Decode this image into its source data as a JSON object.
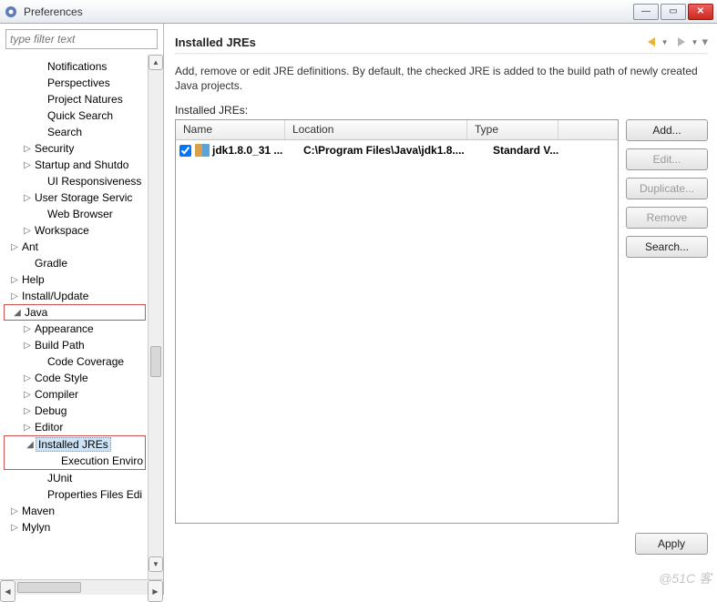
{
  "window": {
    "title": "Preferences"
  },
  "filter": {
    "placeholder": "type filter text"
  },
  "tree": {
    "items": [
      {
        "ind": 2,
        "tw": "",
        "lbl": "Notifications"
      },
      {
        "ind": 2,
        "tw": "",
        "lbl": "Perspectives"
      },
      {
        "ind": 2,
        "tw": "",
        "lbl": "Project Natures"
      },
      {
        "ind": 2,
        "tw": "",
        "lbl": "Quick Search"
      },
      {
        "ind": 2,
        "tw": "",
        "lbl": "Search"
      },
      {
        "ind": 1,
        "tw": "▷",
        "lbl": "Security"
      },
      {
        "ind": 1,
        "tw": "▷",
        "lbl": "Startup and Shutdo"
      },
      {
        "ind": 2,
        "tw": "",
        "lbl": "UI Responsiveness"
      },
      {
        "ind": 1,
        "tw": "▷",
        "lbl": "User Storage Servic"
      },
      {
        "ind": 2,
        "tw": "",
        "lbl": "Web Browser"
      },
      {
        "ind": 1,
        "tw": "▷",
        "lbl": "Workspace"
      },
      {
        "ind": 0,
        "tw": "▷",
        "lbl": "Ant"
      },
      {
        "ind": 1,
        "tw": "",
        "lbl": "Gradle"
      },
      {
        "ind": 0,
        "tw": "▷",
        "lbl": "Help"
      },
      {
        "ind": 0,
        "tw": "▷",
        "lbl": "Install/Update"
      },
      {
        "ind": 0,
        "tw": "◢",
        "lbl": "Java",
        "box": true
      },
      {
        "ind": 1,
        "tw": "▷",
        "lbl": "Appearance"
      },
      {
        "ind": 1,
        "tw": "▷",
        "lbl": "Build Path"
      },
      {
        "ind": 2,
        "tw": "",
        "lbl": "Code Coverage"
      },
      {
        "ind": 1,
        "tw": "▷",
        "lbl": "Code Style"
      },
      {
        "ind": 1,
        "tw": "▷",
        "lbl": "Compiler"
      },
      {
        "ind": 1,
        "tw": "▷",
        "lbl": "Debug"
      },
      {
        "ind": 1,
        "tw": "▷",
        "lbl": "Editor"
      },
      {
        "ind": 1,
        "tw": "◢",
        "lbl": "Installed JREs",
        "sel": true,
        "box2": true
      },
      {
        "ind": 3,
        "tw": "",
        "lbl": "Execution Enviro",
        "box2": true
      },
      {
        "ind": 2,
        "tw": "",
        "lbl": "JUnit"
      },
      {
        "ind": 2,
        "tw": "",
        "lbl": "Properties Files Edi"
      },
      {
        "ind": 0,
        "tw": "▷",
        "lbl": "Maven"
      },
      {
        "ind": 0,
        "tw": "▷",
        "lbl": "Mylyn"
      }
    ]
  },
  "page": {
    "heading": "Installed JREs",
    "description": "Add, remove or edit JRE definitions. By default, the checked JRE is added to the build path of newly created Java projects.",
    "list_label": "Installed JREs:",
    "columns": {
      "c1": "Name",
      "c2": "Location",
      "c3": "Type"
    },
    "row": {
      "checked": true,
      "name": "jdk1.8.0_31 ...",
      "location": "C:\\Program Files\\Java\\jdk1.8....",
      "type": "Standard V..."
    },
    "buttons": {
      "add": "Add...",
      "edit": "Edit...",
      "dup": "Duplicate...",
      "remove": "Remove",
      "search": "Search..."
    },
    "apply": "Apply"
  },
  "watermark": "@51C       客"
}
